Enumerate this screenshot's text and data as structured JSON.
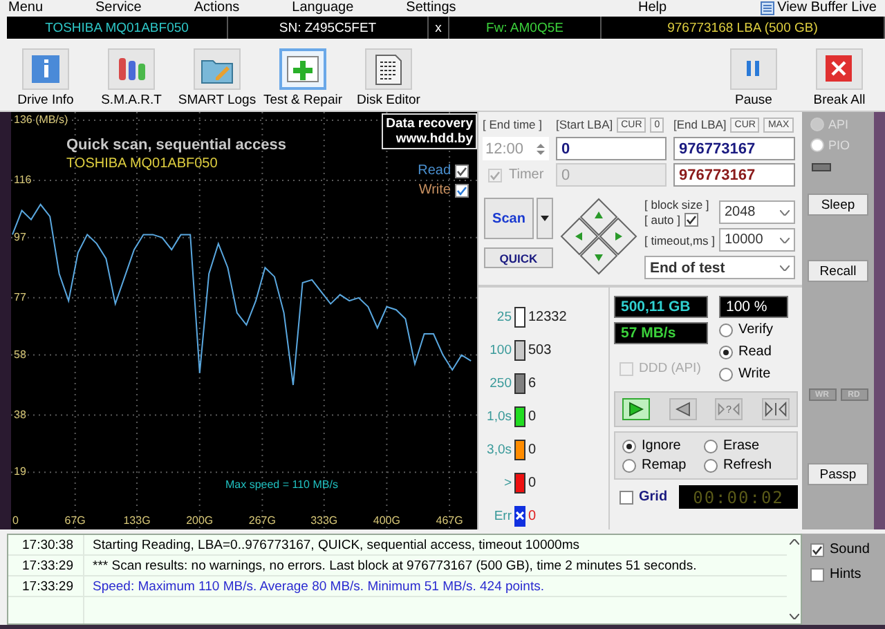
{
  "menu": [
    "Menu",
    "Service",
    "Actions",
    "Language",
    "Settings"
  ],
  "menu_right": [
    {
      "kind": "text",
      "label": "Help"
    },
    {
      "kind": "buffer",
      "label": "View Buffer Live"
    }
  ],
  "drive_bar": {
    "model": "TOSHIBA MQ01ABF050",
    "serial": "SN: Z495C5FET",
    "close": "x",
    "firmware": "Fw: AM0Q5E",
    "capacity": "976773168 LBA (500 GB)"
  },
  "toolbar": [
    {
      "kind": "info",
      "label": "Drive Info",
      "selected": false
    },
    {
      "kind": "smart",
      "label": "S.M.A.R.T",
      "selected": false
    },
    {
      "kind": "logs",
      "label": "SMART Logs",
      "selected": false
    },
    {
      "kind": "repair",
      "label": "Test & Repair",
      "selected": true
    },
    {
      "kind": "editor",
      "label": "Disk Editor",
      "selected": false
    }
  ],
  "toolbar_right": [
    {
      "kind": "pause",
      "label": "Pause"
    },
    {
      "kind": "break",
      "label": "Break All"
    }
  ],
  "graph": {
    "title": "Quick scan, sequential access",
    "model": "TOSHIBA MQ01ABF050",
    "badge": [
      "Data recovery",
      "www.hdd.by"
    ],
    "toggles": [
      {
        "kind": "read",
        "label": "Read",
        "checked": true
      },
      {
        "kind": "write",
        "label": "Write",
        "checked": true
      }
    ],
    "max_speed": "Max speed = 110 MB/s",
    "chart_data": {
      "type": "line",
      "grid": true,
      "xlim": [
        0,
        495
      ],
      "ylim": [
        0,
        136
      ],
      "xticks": [
        {
          "value": 0,
          "label": "0"
        },
        {
          "value": 67,
          "label": "67G"
        },
        {
          "value": 133,
          "label": "133G"
        },
        {
          "value": 200,
          "label": "200G"
        },
        {
          "value": 267,
          "label": "267G"
        },
        {
          "value": 333,
          "label": "333G"
        },
        {
          "value": 400,
          "label": "400G"
        },
        {
          "value": 467,
          "label": "467G"
        }
      ],
      "yticks": [
        {
          "value": 136,
          "label": "136 (MB/s)"
        },
        {
          "value": 116,
          "label": "116"
        },
        {
          "value": 97,
          "label": "97"
        },
        {
          "value": 77,
          "label": "77"
        },
        {
          "value": 58,
          "label": "58"
        },
        {
          "value": 38,
          "label": "38"
        },
        {
          "value": 19,
          "label": "19"
        }
      ],
      "x": [
        0,
        10,
        20,
        30,
        40,
        50,
        60,
        70,
        80,
        90,
        100,
        110,
        120,
        130,
        140,
        150,
        160,
        170,
        180,
        190,
        200,
        210,
        220,
        230,
        240,
        250,
        260,
        270,
        280,
        290,
        300,
        310,
        320,
        330,
        340,
        350,
        360,
        370,
        380,
        390,
        400,
        410,
        420,
        430,
        440,
        450,
        460,
        470,
        480,
        490
      ],
      "series": [
        {
          "color": "#5aa8e0",
          "values": [
            98,
            106,
            103,
            108,
            104,
            85,
            76,
            92,
            98,
            95,
            90,
            75,
            84,
            93,
            98,
            98,
            97,
            93,
            98,
            98,
            52,
            85,
            95,
            87,
            72,
            68,
            76,
            87,
            84,
            72,
            48,
            82,
            83,
            79,
            75,
            78,
            76,
            77,
            74,
            67,
            74,
            73,
            70,
            55,
            65,
            65,
            58,
            53,
            58,
            56
          ]
        }
      ]
    }
  },
  "range": {
    "end_time_label": "[ End time ]",
    "start_label": "[Start LBA]",
    "start_cur": "CUR",
    "start_cur_value": "0",
    "end_label": "[End LBA]",
    "end_cur": "CUR",
    "end_max": "MAX",
    "end_time": "12:00",
    "start": "0",
    "end": "976773167",
    "timer": {
      "label": "Timer",
      "checked": true,
      "disabled": true
    },
    "timer_value": "0",
    "end_current": "976773167"
  },
  "scan": {
    "label": "Scan",
    "quick": "QUICK",
    "block_size_label": "[ block size ]",
    "auto_label": "[ auto ]",
    "auto_checked": true,
    "timeout_label": "[ timeout,ms ]",
    "block_size": "2048",
    "timeout": "10000",
    "finish": "End of test"
  },
  "sectors": [
    {
      "label": "25",
      "count": "12332",
      "color": "#ffffff",
      "kind": "normal"
    },
    {
      "label": "100",
      "count": "503",
      "color": "#c8c8c8",
      "kind": "normal"
    },
    {
      "label": "250",
      "count": "6",
      "color": "#808080",
      "kind": "normal"
    },
    {
      "label": "1,0s",
      "count": "0",
      "color": "#22dd22",
      "kind": "normal"
    },
    {
      "label": "3,0s",
      "count": "0",
      "color": "#ff8c00",
      "kind": "normal"
    },
    {
      "label": ">",
      "count": "0",
      "color": "#ee1111",
      "kind": "normal"
    },
    {
      "label": "Err",
      "count": "0",
      "color": "#1030e0",
      "kind": "error"
    }
  ],
  "stats": {
    "done": "500,11 GB",
    "percent": "100 %",
    "speed": "57 MB/s"
  },
  "modes": [
    {
      "label": "Verify",
      "selected": false
    },
    {
      "label": "Read",
      "selected": true
    },
    {
      "label": "Write",
      "selected": false
    }
  ],
  "ddd": {
    "label": "DDD (API)",
    "checked": false,
    "disabled": true
  },
  "transport": [
    {
      "kind": "play",
      "selected": true
    },
    {
      "kind": "back",
      "selected": false
    },
    {
      "kind": "check",
      "label": "?",
      "selected": false
    },
    {
      "kind": "end",
      "selected": false
    }
  ],
  "actions": [
    {
      "label": "Ignore",
      "selected": true
    },
    {
      "label": "Erase",
      "selected": false
    },
    {
      "label": "Remap",
      "selected": false
    },
    {
      "label": "Refresh",
      "selected": false
    }
  ],
  "grid": {
    "label": "Grid",
    "checked": false
  },
  "elapsed": "00:00:02",
  "side": {
    "access": [
      {
        "label": "API",
        "selected": true
      },
      {
        "label": "PIO",
        "selected": false
      }
    ],
    "sleep": "Sleep",
    "recall": "Recall",
    "wr": "WR",
    "rd": "RD",
    "passp": "Passp"
  },
  "log": [
    {
      "time": "17:30:38",
      "text": "Starting Reading, LBA=0..976773167, QUICK, sequential access, timeout 10000ms",
      "kind": "info"
    },
    {
      "time": "17:33:29",
      "text": "*** Scan results: no warnings, no errors. Last block at 976773167 (500 GB), time 2 minutes 51 seconds.",
      "kind": "info"
    },
    {
      "time": "17:33:29",
      "text": "Speed: Maximum 110 MB/s. Average 80 MB/s. Minimum 51 MB/s. 424 points.",
      "kind": "speed"
    }
  ],
  "options": [
    {
      "label": "Sound",
      "checked": true
    },
    {
      "label": "Hints",
      "checked": false
    }
  ]
}
